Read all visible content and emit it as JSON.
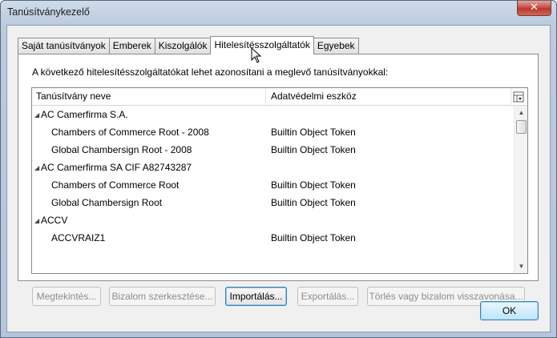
{
  "window": {
    "title": "Tanúsítványkezelő",
    "close_glyph": "✕"
  },
  "tabs": [
    {
      "label": "Saját tanúsítványok",
      "active": false
    },
    {
      "label": "Emberek",
      "active": false
    },
    {
      "label": "Kiszolgálók",
      "active": false
    },
    {
      "label": "Hitelesítésszolgáltatók",
      "active": true
    },
    {
      "label": "Egyebek",
      "active": false
    }
  ],
  "panel": {
    "description": "A következő hitelesítésszolgáltatókat lehet azonosítani a meglevő tanúsítványokkal:"
  },
  "tree": {
    "columns": [
      "Tanúsítvány neve",
      "Adatvédelmi eszköz"
    ],
    "rows": [
      {
        "type": "group",
        "name": "AC Camerfirma S.A.",
        "device": ""
      },
      {
        "type": "child",
        "name": "Chambers of Commerce Root - 2008",
        "device": "Builtin Object Token"
      },
      {
        "type": "child",
        "name": "Global Chambersign Root - 2008",
        "device": "Builtin Object Token"
      },
      {
        "type": "group",
        "name": "AC Camerfirma SA CIF A82743287",
        "device": ""
      },
      {
        "type": "child",
        "name": "Chambers of Commerce Root",
        "device": "Builtin Object Token"
      },
      {
        "type": "child",
        "name": "Global Chambersign Root",
        "device": "Builtin Object Token"
      },
      {
        "type": "group",
        "name": "ACCV",
        "device": ""
      },
      {
        "type": "child",
        "name": "ACCVRAIZ1",
        "device": "Builtin Object Token"
      }
    ],
    "twisty_glyph": "◢"
  },
  "buttons": {
    "view": "Megtekintés...",
    "edit_trust": "Bizalom szerkesztése...",
    "import": "Importálás...",
    "export": "Exportálás...",
    "delete": "Törlés vagy bizalom visszavonása...",
    "ok": "OK"
  }
}
